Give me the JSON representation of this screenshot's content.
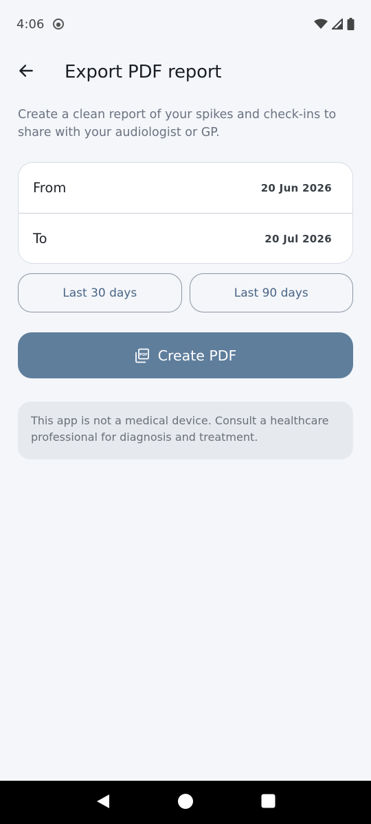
{
  "status_bar": {
    "time": "4:06",
    "left_icons": [
      "notification-icon"
    ],
    "right_icons": [
      "wifi-icon",
      "signal-icon",
      "battery-icon"
    ]
  },
  "app_bar": {
    "back_icon": "arrow-back-icon",
    "title": "Export PDF report"
  },
  "description": "Create a clean report of your spikes and check-ins to share with your audiologist or GP.",
  "date_range": {
    "from_label": "From",
    "from_value": "20 Jun 2026",
    "to_label": "To",
    "to_value": "20 Jul 2026"
  },
  "quick_ranges": [
    {
      "label": "Last 30 days"
    },
    {
      "label": "Last 90 days"
    }
  ],
  "primary_action": {
    "icon": "pdf-icon",
    "label": "Create PDF"
  },
  "disclaimer": "This app is not a medical device. Consult a healthcare professional for diagnosis and treatment.",
  "nav_bar": {
    "icons": [
      "nav-back-icon",
      "nav-home-icon",
      "nav-recents-icon"
    ]
  },
  "colors": {
    "background": "#f4f6fa",
    "primary": "#5f7e9c",
    "outline_text": "#4a6584",
    "disclaimer_bg": "#e6e9ee"
  }
}
